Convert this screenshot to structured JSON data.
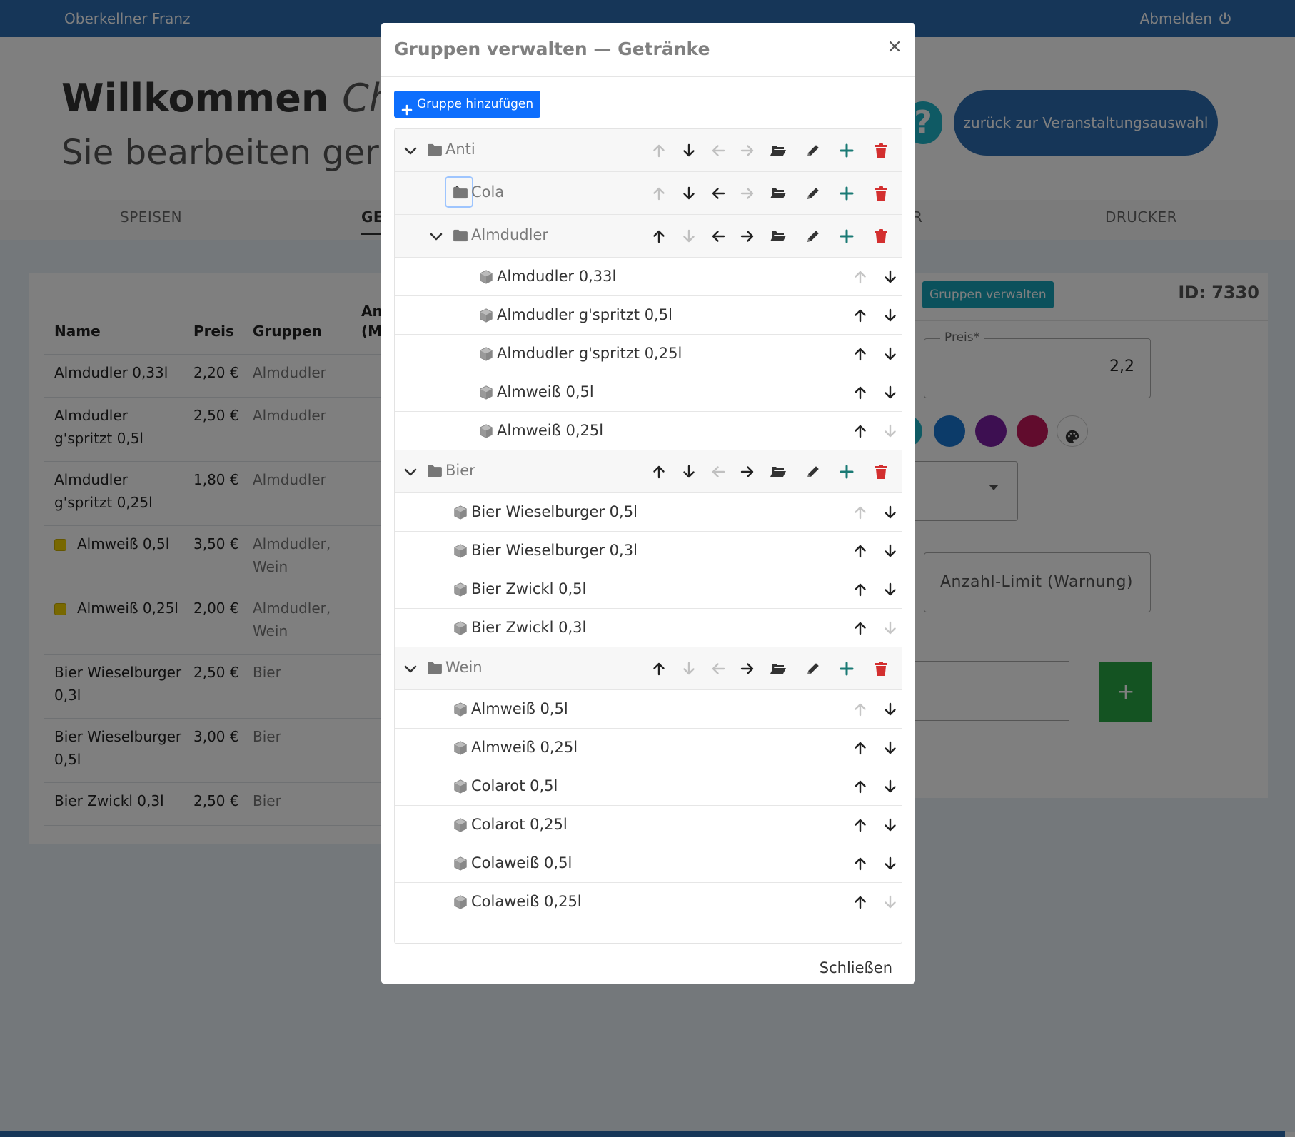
{
  "topbar": {
    "user": "Oberkellner Franz",
    "logout": "Abmelden"
  },
  "header": {
    "welcome": "Willkommen",
    "welcome_name": "Christ",
    "subline": "Sie bearbeiten gerade",
    "help": "?",
    "back_button": "zurück zur Veranstaltungsauswahl"
  },
  "nav": {
    "tabs": [
      "SPEISEN",
      "GE",
      "R",
      "DRUCKER"
    ]
  },
  "table": {
    "headers": [
      "Name",
      "Preis",
      "Gruppen",
      "An",
      "(M"
    ],
    "rows": [
      {
        "name": [
          "Almdudler 0,33l"
        ],
        "price": "2,20 €",
        "groups": [
          "Almdudler"
        ],
        "swatch": false
      },
      {
        "name": [
          "Almdudler",
          "g'spritzt 0,5l"
        ],
        "price": "2,50 €",
        "groups": [
          "Almdudler"
        ],
        "swatch": false
      },
      {
        "name": [
          "Almdudler",
          "g'spritzt 0,25l"
        ],
        "price": "1,80 €",
        "groups": [
          "Almdudler"
        ],
        "swatch": false
      },
      {
        "name": [
          "Almweiß 0,5l"
        ],
        "price": "3,50 €",
        "groups": [
          "Almdudler,",
          "Wein"
        ],
        "swatch": true
      },
      {
        "name": [
          "Almweiß 0,25l"
        ],
        "price": "2,00 €",
        "groups": [
          "Almdudler,",
          "Wein"
        ],
        "swatch": true
      },
      {
        "name": [
          "Bier Wieselburger",
          "0,3l"
        ],
        "price": "2,50 €",
        "groups": [
          "Bier"
        ],
        "swatch": false
      },
      {
        "name": [
          "Bier Wieselburger",
          "0,5l"
        ],
        "price": "3,00 €",
        "groups": [
          "Bier"
        ],
        "swatch": false
      },
      {
        "name": [
          "Bier Zwickl 0,3l"
        ],
        "price": "2,50 €",
        "groups": [
          "Bier"
        ],
        "swatch": false
      }
    ]
  },
  "editor": {
    "groups_button": "Gruppen verwalten",
    "id_label": "ID: 7330",
    "price_legend": "Preis*",
    "price_value": "2,2",
    "limit_placeholder": "Anzahl-Limit (Warnung)",
    "add_symbol": "+",
    "colors": [
      "#1fb5c9",
      "#1976d2",
      "#7b1fa2",
      "#c2185b"
    ]
  },
  "modal": {
    "title": "Gruppen verwalten — Getränke",
    "close_symbol": "×",
    "add_group_button": "Gruppe hinzufügen",
    "close_button": "Schließen",
    "tree": [
      {
        "type": "group",
        "level": 0,
        "label": "Anti",
        "expanded": true,
        "up": false,
        "down": true,
        "left": false,
        "right": false
      },
      {
        "type": "group",
        "level": 1,
        "label": "Cola",
        "expanded": false,
        "focused": true,
        "up": false,
        "down": true,
        "left": true,
        "right": false
      },
      {
        "type": "group",
        "level": 1,
        "label": "Almdudler",
        "expanded": true,
        "up": true,
        "down": false,
        "left": true,
        "right": true
      },
      {
        "type": "item",
        "level": 2,
        "label": "Almdudler 0,33l",
        "up": false,
        "down": true
      },
      {
        "type": "item",
        "level": 2,
        "label": "Almdudler g'spritzt 0,5l",
        "up": true,
        "down": true
      },
      {
        "type": "item",
        "level": 2,
        "label": "Almdudler g'spritzt 0,25l",
        "up": true,
        "down": true
      },
      {
        "type": "item",
        "level": 2,
        "label": "Almweiß 0,5l",
        "up": true,
        "down": true
      },
      {
        "type": "item",
        "level": 2,
        "label": "Almweiß 0,25l",
        "up": true,
        "down": false
      },
      {
        "type": "group",
        "level": 0,
        "label": "Bier",
        "expanded": true,
        "up": true,
        "down": true,
        "left": false,
        "right": true
      },
      {
        "type": "item",
        "level": 1,
        "label": "Bier Wieselburger 0,5l",
        "up": false,
        "down": true
      },
      {
        "type": "item",
        "level": 1,
        "label": "Bier Wieselburger 0,3l",
        "up": true,
        "down": true
      },
      {
        "type": "item",
        "level": 1,
        "label": "Bier Zwickl 0,5l",
        "up": true,
        "down": true
      },
      {
        "type": "item",
        "level": 1,
        "label": "Bier Zwickl 0,3l",
        "up": true,
        "down": false
      },
      {
        "type": "group",
        "level": 0,
        "label": "Wein",
        "expanded": true,
        "up": true,
        "down": false,
        "left": false,
        "right": true
      },
      {
        "type": "item",
        "level": 1,
        "label": "Almweiß 0,5l",
        "up": false,
        "down": true
      },
      {
        "type": "item",
        "level": 1,
        "label": "Almweiß 0,25l",
        "up": true,
        "down": true
      },
      {
        "type": "item",
        "level": 1,
        "label": "Colarot 0,5l",
        "up": true,
        "down": true
      },
      {
        "type": "item",
        "level": 1,
        "label": "Colarot 0,25l",
        "up": true,
        "down": true
      },
      {
        "type": "item",
        "level": 1,
        "label": "Colaweiß 0,5l",
        "up": true,
        "down": true
      },
      {
        "type": "item",
        "level": 1,
        "label": "Colaweiß 0,25l",
        "up": true,
        "down": false
      }
    ]
  },
  "colors": {
    "primary": "#2c6db1",
    "teal": "#17a2b8",
    "add_blue": "#0d6efd",
    "plus_green": "#1a7a74",
    "delete_red": "#d32f2f",
    "success": "#28a745"
  }
}
